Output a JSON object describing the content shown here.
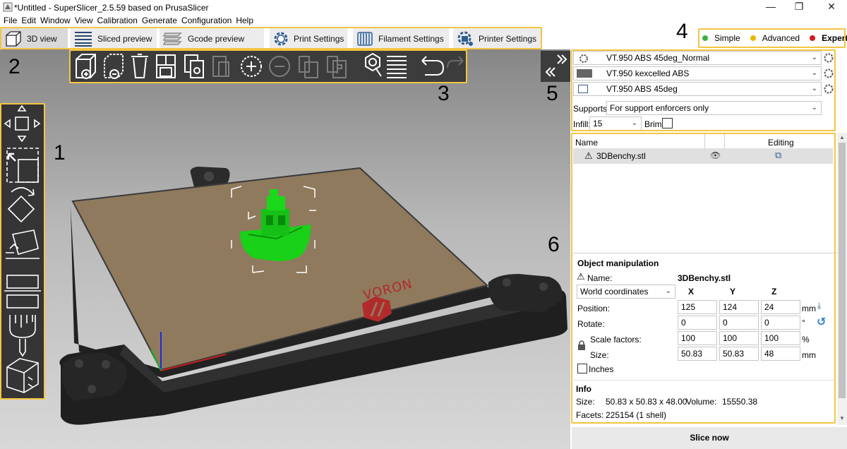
{
  "window": {
    "title": "*Untitled - SuperSlicer_2.5.59  based on PrusaSlicer",
    "min_glyph": "—",
    "max_glyph": "❐",
    "close_glyph": "✕"
  },
  "menu": [
    "File",
    "Edit",
    "Window",
    "View",
    "Calibration",
    "Generate",
    "Configuration",
    "Help"
  ],
  "tabs": [
    {
      "label": "3D view",
      "icon": "cube-icon"
    },
    {
      "label": "Sliced preview",
      "icon": "layers-icon"
    },
    {
      "label": "Gcode preview",
      "icon": "gcode-layers-icon"
    },
    {
      "label": "Print Settings",
      "icon": "gear-icon"
    },
    {
      "label": "Filament Settings",
      "icon": "spool-icon"
    },
    {
      "label": "Printer Settings",
      "icon": "printer-gear-icon"
    }
  ],
  "modes": [
    {
      "label": "Simple",
      "color": "#3cb043"
    },
    {
      "label": "Advanced",
      "color": "#e5b800"
    },
    {
      "label": "Expert",
      "color": "#d21a1a"
    }
  ],
  "callouts": [
    "1",
    "2",
    "3",
    "4",
    "5",
    "6"
  ],
  "toolbar_icons": [
    "add-icon",
    "delete-icon",
    "delete-all-icon",
    "arrange-icon",
    "copy-icon",
    "paste-icon",
    "add-instance-icon",
    "remove-instance-icon",
    "split-objects-icon",
    "split-parts-icon",
    "search-icon",
    "layers-editing-icon",
    "undo-icon",
    "redo-icon"
  ],
  "left_tool_icons": [
    "move-icon",
    "select-icon",
    "rotate-icon",
    "place-on-face-icon",
    "cut-icon",
    "support-paint-icon",
    "seam-paint-icon"
  ],
  "bed_logo": "VORON",
  "presets": {
    "print": "VT.950 ABS 45deg_Normal",
    "filament": "VT.950 kexcelled ABS",
    "printer": "VT.950 ABS 45deg",
    "filament_color": "#666666"
  },
  "supports": {
    "label": "Supports:",
    "value": "For support enforcers only"
  },
  "infill": {
    "label": "Infill:",
    "value": "15"
  },
  "brim": {
    "label": "Brim:"
  },
  "objects": {
    "headers": {
      "name": "Name",
      "editing": "Editing"
    },
    "rows": [
      {
        "name": "3DBenchy.stl"
      }
    ]
  },
  "manipulation": {
    "title": "Object manipulation",
    "name_label": "Name:",
    "name_value": "3DBenchy.stl",
    "coord_system": "World coordinates",
    "axes": [
      "X",
      "Y",
      "Z"
    ],
    "position": {
      "label": "Position:",
      "values": [
        "125",
        "124",
        "24"
      ],
      "unit": "mm"
    },
    "rotate": {
      "label": "Rotate:",
      "values": [
        "0",
        "0",
        "0"
      ],
      "unit": "°"
    },
    "scale": {
      "label": "Scale factors:",
      "values": [
        "100",
        "100",
        "100"
      ],
      "unit": "%"
    },
    "size": {
      "label": "Size:",
      "values": [
        "50.83",
        "50.83",
        "48"
      ],
      "unit": "mm"
    },
    "inches_label": "Inches"
  },
  "info": {
    "title": "Info",
    "size_label": "Size:",
    "size_value": "50.83 x 50.83 x 48.00",
    "volume_label": "Volume:",
    "volume_value": "15550.38",
    "facets_label": "Facets:",
    "facets_value": "225154 (1 shell)"
  },
  "slice_button": "Slice now",
  "colors": {
    "highlight": "#f4c542",
    "model": "#18d118",
    "bed": "#8f7a5e",
    "toolbar": "#3c3c3c"
  }
}
